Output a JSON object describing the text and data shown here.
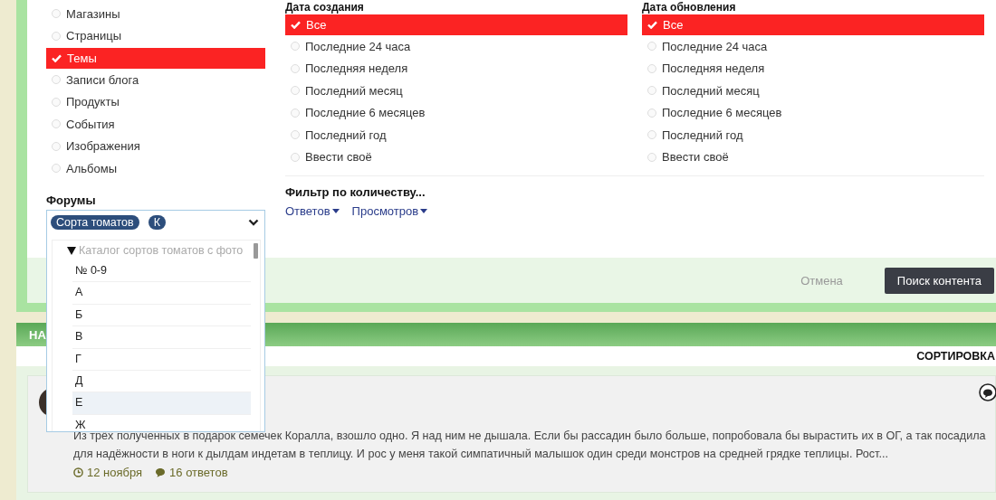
{
  "content_types": [
    {
      "label": "Магазины",
      "selected": false
    },
    {
      "label": "Страницы",
      "selected": false
    },
    {
      "label": "Темы",
      "selected": true
    },
    {
      "label": "Записи блога",
      "selected": false
    },
    {
      "label": "Продукты",
      "selected": false
    },
    {
      "label": "События",
      "selected": false
    },
    {
      "label": "Изображения",
      "selected": false
    },
    {
      "label": "Альбомы",
      "selected": false
    }
  ],
  "date_created": {
    "title": "Дата создания",
    "options": [
      {
        "label": "Все",
        "selected": true
      },
      {
        "label": "Последние 24 часа",
        "selected": false
      },
      {
        "label": "Последняя неделя",
        "selected": false
      },
      {
        "label": "Последний месяц",
        "selected": false
      },
      {
        "label": "Последние 6 месяцев",
        "selected": false
      },
      {
        "label": "Последний год",
        "selected": false
      },
      {
        "label": "Ввести своё",
        "selected": false
      }
    ]
  },
  "date_updated": {
    "title": "Дата обновления",
    "options": [
      {
        "label": "Все",
        "selected": true
      },
      {
        "label": "Последние 24 часа",
        "selected": false
      },
      {
        "label": "Последняя неделя",
        "selected": false
      },
      {
        "label": "Последний месяц",
        "selected": false
      },
      {
        "label": "Последние 6 месяцев",
        "selected": false
      },
      {
        "label": "Последний год",
        "selected": false
      },
      {
        "label": "Ввести своё",
        "selected": false
      }
    ]
  },
  "count_filter": {
    "title": "Фильтр по количеству...",
    "links": [
      "Ответов",
      "Просмотров"
    ]
  },
  "actions": {
    "cancel": "Отмена",
    "submit": "Поиск контента"
  },
  "forums": {
    "label": "Форумы",
    "tags": [
      "Сорта томатов",
      "К"
    ],
    "tree": {
      "label": "Каталог сортов томатов с фото",
      "expanded": true,
      "children": [
        {
          "label": "№ 0-9",
          "highlighted": false
        },
        {
          "label": "А",
          "highlighted": false
        },
        {
          "label": "Б",
          "highlighted": false
        },
        {
          "label": "В",
          "highlighted": false
        },
        {
          "label": "Г",
          "highlighted": false
        },
        {
          "label": "Д",
          "highlighted": false
        },
        {
          "label": "Е",
          "highlighted": true
        },
        {
          "label": "Ж",
          "highlighted": false
        }
      ]
    }
  },
  "results": {
    "header": "НА",
    "sort": "СОРТИРОВКА",
    "post": {
      "text": "Из трёх полученных в подарок семечек Коралла, взошло одно. Я над ним не дышала. Если бы рассадин было больше, попробовала бы вырастить их в ОГ, а так посадила для надёжности в ноги к дылдам индетам в теплицу. И рос у меня такой симпатичный малышок один среди монстров на средней грядке теплицы. Рост...",
      "date": "12 ноября",
      "replies": "16 ответов"
    }
  }
}
